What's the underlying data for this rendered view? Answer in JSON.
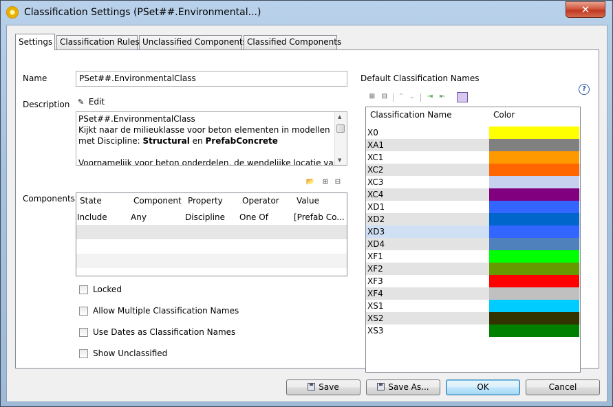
{
  "window": {
    "title": "Classification Settings (PSet##.Environmental...)",
    "close_label": "✕"
  },
  "tabs": [
    "Settings",
    "Classification Rules",
    "Unclassified Components",
    "Classified Components"
  ],
  "settings": {
    "name_label": "Name",
    "name_value": "PSet##.EnvironmentalClass",
    "description_label": "Description",
    "edit_label": "Edit",
    "description_lines": [
      {
        "parts": [
          {
            "t": "PSet##.EnvironmentalClass",
            "b": false
          }
        ]
      },
      {
        "parts": [
          {
            "t": "Kijkt naar de milieuklasse voor beton elementen in modellen",
            "b": false
          }
        ]
      },
      {
        "parts": [
          {
            "t": "met Discipline: ",
            "b": false
          },
          {
            "t": "Structural",
            "b": true
          },
          {
            "t": " en ",
            "b": false
          },
          {
            "t": "PrefabConcrete",
            "b": true
          }
        ]
      },
      {
        "parts": [
          {
            "t": "",
            "b": false
          }
        ]
      },
      {
        "parts": [
          {
            "t": "Voornamelijk voor beton onderdelen, de wendelijke locatie van",
            "b": false
          }
        ]
      }
    ],
    "components_label": "Components",
    "components_columns": [
      "State",
      "Component",
      "Property",
      "Operator",
      "Value"
    ],
    "components_rows": [
      [
        "Include",
        "Any",
        "Discipline",
        "One Of",
        "[Prefab Co..."
      ]
    ],
    "checkboxes": [
      {
        "label": "Locked",
        "checked": false
      },
      {
        "label": "Allow Multiple Classification Names",
        "checked": false
      },
      {
        "label": "Use Dates as Classification Names",
        "checked": false
      },
      {
        "label": "Show Unclassified",
        "checked": false
      }
    ]
  },
  "default_names": {
    "heading": "Default Classification Names",
    "columns": [
      "Classification Name",
      "Color"
    ],
    "rows": [
      {
        "name": "X0",
        "color": "#ffff00"
      },
      {
        "name": "XA1",
        "color": "#808080"
      },
      {
        "name": "XC1",
        "color": "#ff9900"
      },
      {
        "name": "XC2",
        "color": "#ff6600"
      },
      {
        "name": "XC3",
        "color": "#c8d0f0"
      },
      {
        "name": "XC4",
        "color": "#800080"
      },
      {
        "name": "XD1",
        "color": "#3366ff"
      },
      {
        "name": "XD2",
        "color": "#0066cc"
      },
      {
        "name": "XD3",
        "color": "#3366ff"
      },
      {
        "name": "XD4",
        "color": "#4f81bd"
      },
      {
        "name": "XF1",
        "color": "#00ff00"
      },
      {
        "name": "XF2",
        "color": "#669900"
      },
      {
        "name": "XF3",
        "color": "#ff0000"
      },
      {
        "name": "XF4",
        "color": "#c0c0c0"
      },
      {
        "name": "XS1",
        "color": "#00ccff"
      },
      {
        "name": "XS2",
        "color": "#333300"
      },
      {
        "name": "XS3",
        "color": "#008000"
      }
    ],
    "selected_row": "XD3"
  },
  "buttons": {
    "save": "Save",
    "save_as": "Save As...",
    "ok": "OK",
    "cancel": "Cancel"
  }
}
